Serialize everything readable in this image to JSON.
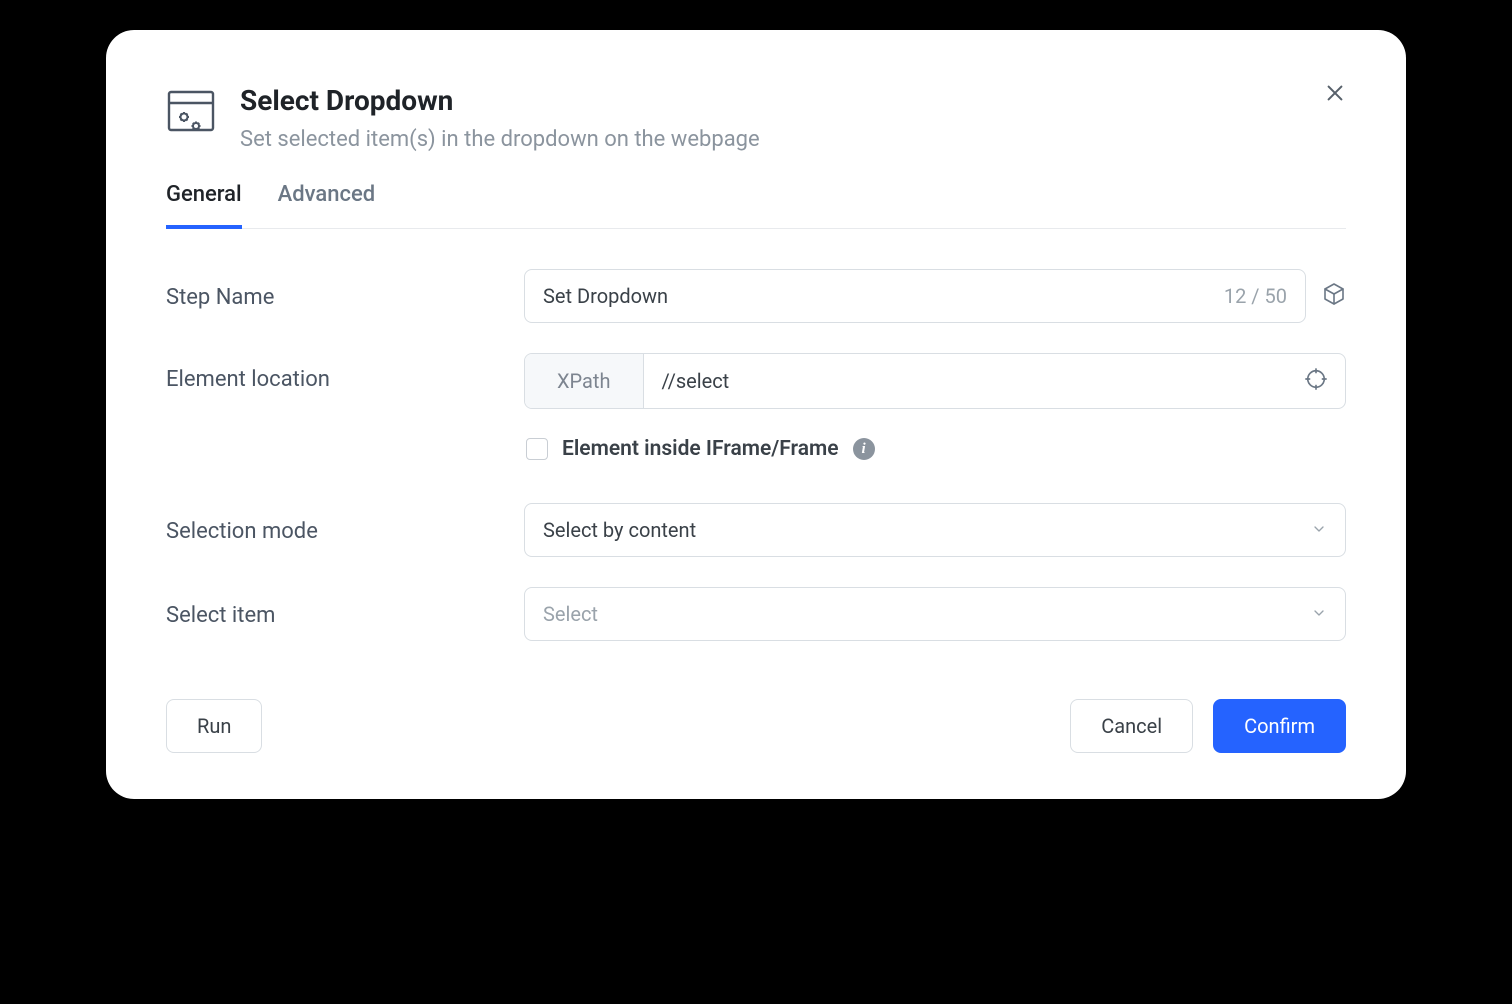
{
  "header": {
    "title": "Select Dropdown",
    "subtitle": "Set selected item(s) in the dropdown on the webpage"
  },
  "tabs": {
    "general": "General",
    "advanced": "Advanced"
  },
  "form": {
    "step_name": {
      "label": "Step Name",
      "value": "Set Dropdown",
      "char_count": "12 / 50"
    },
    "element_location": {
      "label": "Element location",
      "prefix": "XPath",
      "value": "//select"
    },
    "iframe": {
      "label": "Element inside IFrame/Frame"
    },
    "selection_mode": {
      "label": "Selection mode",
      "value": "Select by content"
    },
    "select_item": {
      "label": "Select item",
      "placeholder": "Select"
    }
  },
  "footer": {
    "run": "Run",
    "cancel": "Cancel",
    "confirm": "Confirm"
  }
}
